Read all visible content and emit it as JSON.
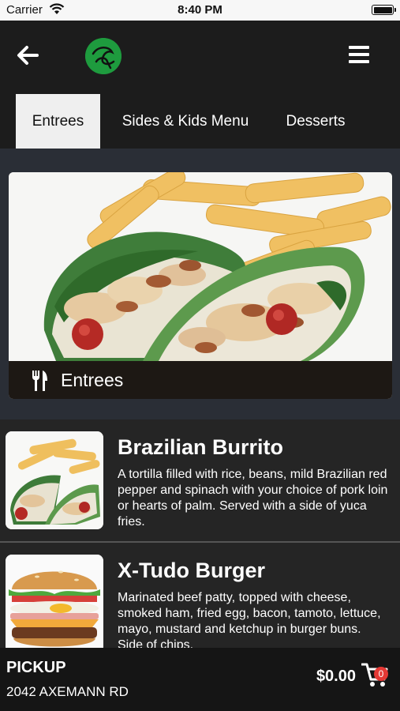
{
  "status_bar": {
    "carrier": "Carrier",
    "time": "8:40 PM"
  },
  "nav": {
    "back_icon": "arrow-left-icon",
    "logo_icon": "restaurant-logo",
    "menu_icon": "hamburger-menu-icon"
  },
  "tabs": [
    {
      "label": "Entrees",
      "active": true
    },
    {
      "label": "Sides & Kids Menu",
      "active": false
    },
    {
      "label": "Desserts",
      "active": false
    }
  ],
  "hero": {
    "caption": "Entrees",
    "caption_icon": "fork-knife-icon"
  },
  "menu_items": [
    {
      "name": "Brazilian Burrito",
      "description": "A tortilla filled with rice, beans, mild Brazilian red pepper and spinach with your choice of pork loin or hearts of palm. Served with a side of yuca fries.",
      "image": "burrito-photo"
    },
    {
      "name": "X-Tudo Burger",
      "description": "Marinated beef patty, topped with cheese, smoked ham, fried egg, bacon, tamoto, lettuce, mayo, mustard and ketchup in burger buns. Side of chips.",
      "image": "burger-photo"
    }
  ],
  "cart": {
    "pickup_label": "PICKUP",
    "address": "2042 AXEMANN RD",
    "total": "$0.00",
    "count": "0",
    "cart_icon": "shopping-cart-icon"
  },
  "colors": {
    "accent": "#1e9b3e",
    "badge": "#e53935",
    "tab_active_bg": "#efefef"
  }
}
